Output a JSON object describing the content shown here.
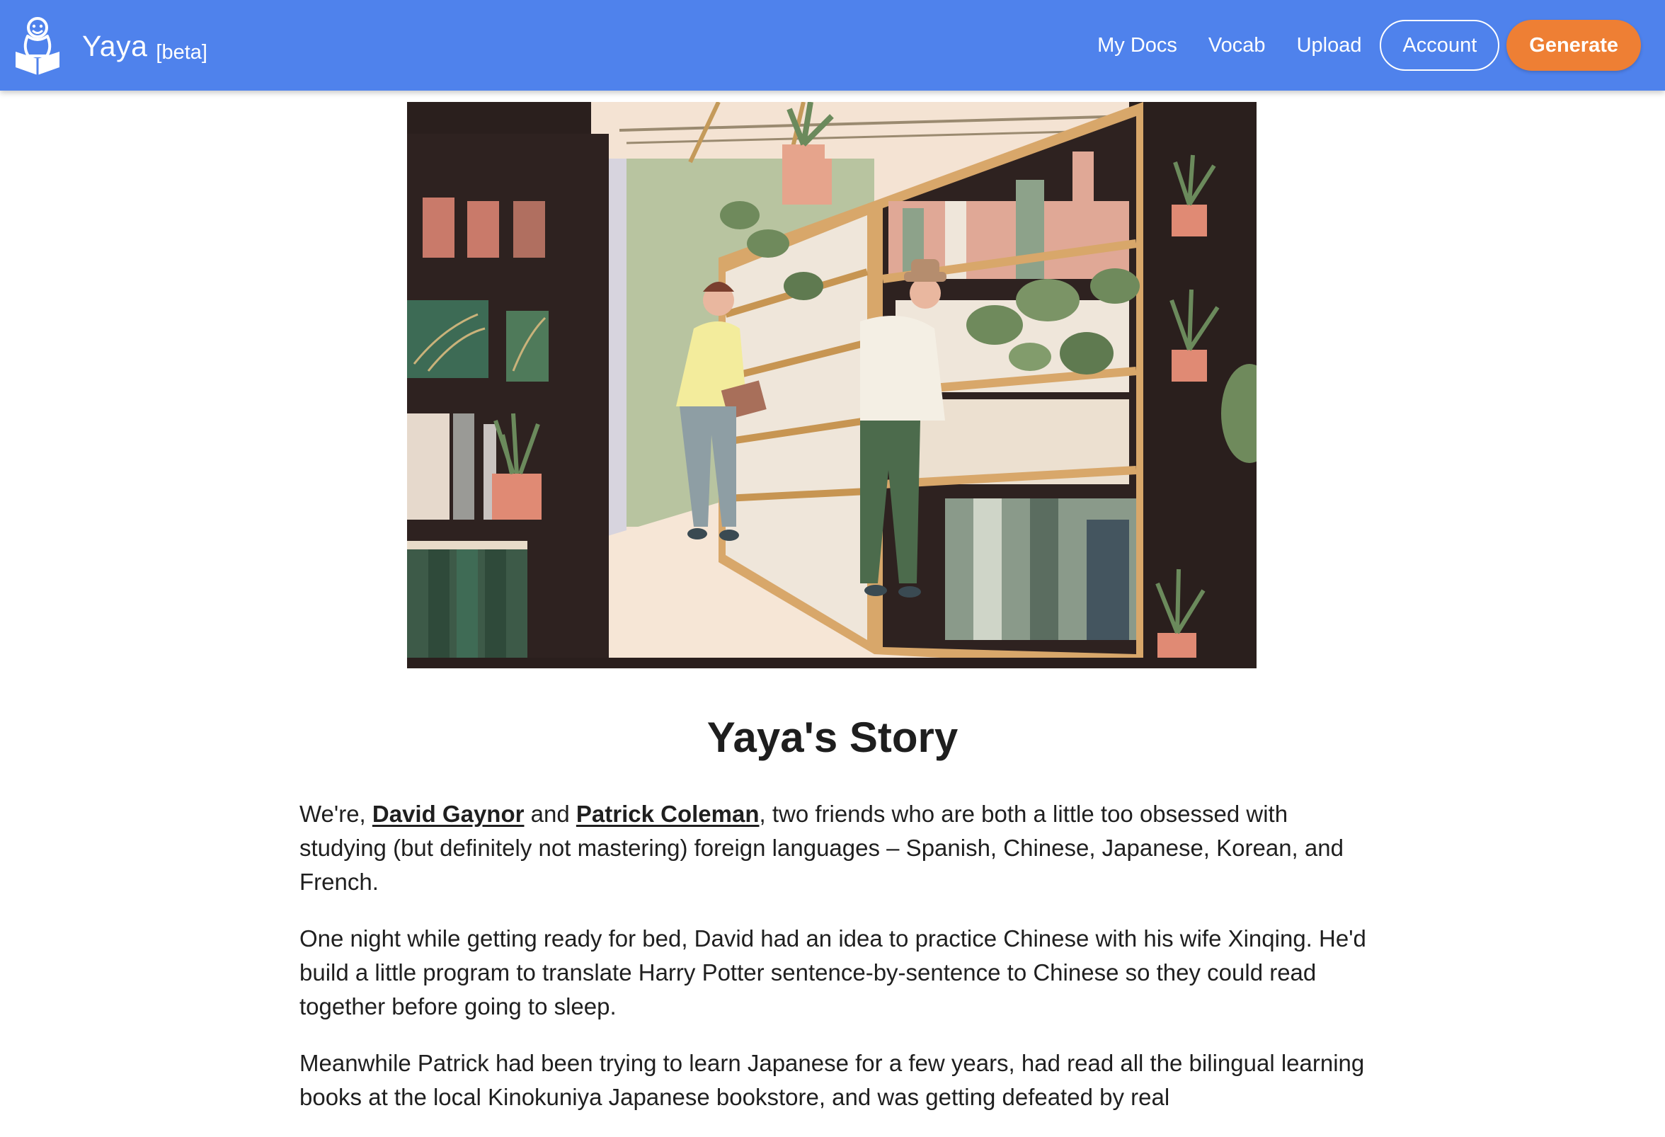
{
  "nav": {
    "brand_name": "Yaya",
    "brand_tag": "[beta]",
    "logo_icon": "duck-reading-book-icon",
    "links": [
      "My Docs",
      "Vocab",
      "Upload"
    ],
    "account_label": "Account",
    "generate_label": "Generate"
  },
  "colors": {
    "nav_bg": "#4f82ec",
    "generate_bg": "#ee7f34"
  },
  "hero": {
    "subject": "illustration-two-people-browsing-bookstore-shelves"
  },
  "article": {
    "title": "Yaya's Story",
    "p1": {
      "before": "We're, ",
      "link1": "David Gaynor",
      "between": " and ",
      "link2": "Patrick Coleman",
      "after": ", two friends who are both a little too obsessed with studying (but definitely not mastering) foreign languages – Spanish, Chinese, Japanese, Korean, and French."
    },
    "p2": "One night while getting ready for bed, David had an idea to practice Chinese with his wife Xinqing. He'd build a little program to translate Harry Potter sentence-by-sentence to Chinese so they could read together before going to sleep.",
    "p3": "Meanwhile Patrick had been trying to learn Japanese for a few years, had read all the bilingual learning books at the local Kinokuniya Japanese bookstore, and was getting defeated by real"
  }
}
